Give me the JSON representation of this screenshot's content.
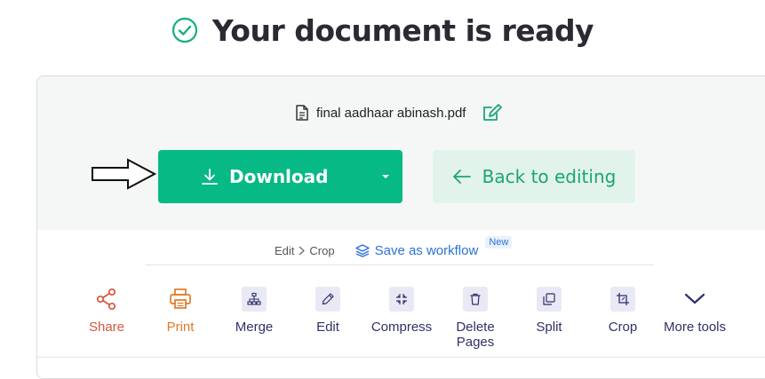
{
  "headline": {
    "text": "Your document is ready"
  },
  "file": {
    "name": "final aadhaar abinash.pdf"
  },
  "actions": {
    "download_label": "Download",
    "back_label": "Back to editing"
  },
  "breadcrumb": {
    "step1": "Edit",
    "step2": "Crop"
  },
  "workflow": {
    "label": "Save as workflow",
    "badge": "New"
  },
  "tools": {
    "share": "Share",
    "print": "Print",
    "merge": "Merge",
    "edit": "Edit",
    "compress": "Compress",
    "delete_line1": "Delete",
    "delete_line2": "Pages",
    "split": "Split",
    "crop": "Crop",
    "more": "More tools"
  },
  "colors": {
    "primary_green": "#07b984",
    "back_bg": "#e2f3ec",
    "back_text": "#1aa577",
    "link_blue": "#2c72d6",
    "share_red": "#d5583b",
    "print_orange": "#e07a29",
    "tool_navy": "#30306a"
  },
  "icons": {
    "headline": "check-circle-icon",
    "file": "file-icon",
    "rename": "edit-pencil-icon",
    "download": "download-icon",
    "back": "arrow-left-icon",
    "workflow": "layers-icon"
  }
}
